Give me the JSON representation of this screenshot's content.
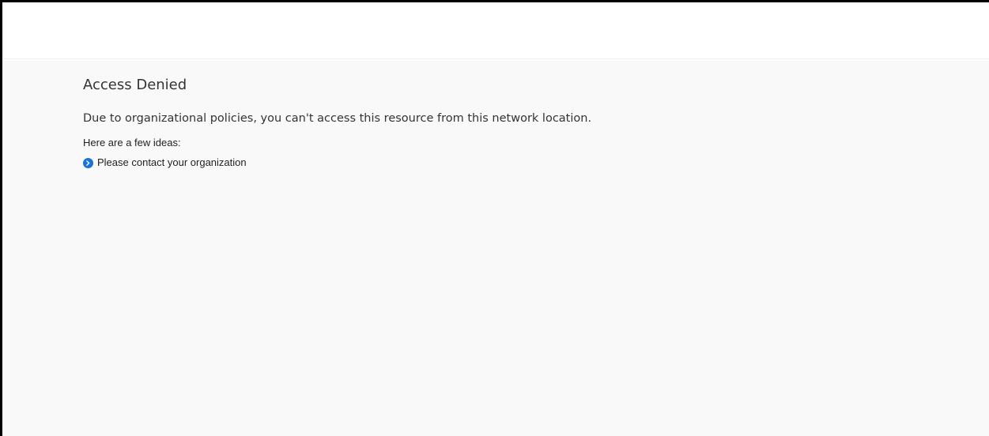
{
  "page": {
    "title": "Access Denied",
    "message": "Due to organizational policies, you can't access this resource from this network location.",
    "ideas_label": "Here are a few ideas:",
    "ideas": [
      {
        "icon": "chevron-right-circle-icon",
        "label": "Please contact your organization"
      }
    ]
  },
  "colors": {
    "accent": "#1a73d9",
    "background": "#f9f9f9",
    "text": "#333333"
  }
}
